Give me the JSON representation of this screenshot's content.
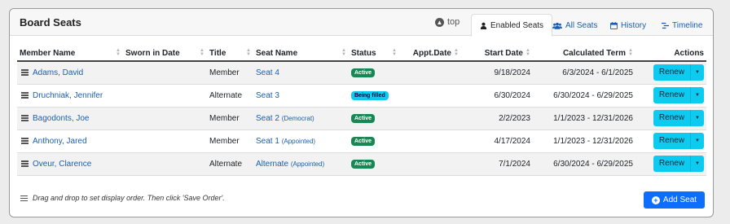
{
  "panel": {
    "title": "Board Seats"
  },
  "nav": {
    "top_label": "top",
    "tabs": [
      {
        "label": "Enabled Seats",
        "icon": "user-icon",
        "active": true
      },
      {
        "label": "All Seats",
        "icon": "users-icon",
        "active": false
      },
      {
        "label": "History",
        "icon": "calendar-icon",
        "active": false
      },
      {
        "label": "Timeline",
        "icon": "timeline-icon",
        "active": false
      }
    ]
  },
  "table": {
    "headers": [
      "Member Name",
      "Sworn in Date",
      "Title",
      "Seat Name",
      "Status",
      "Appt.Date",
      "Start Date",
      "Calculated Term",
      "Actions"
    ],
    "rows": [
      {
        "member": "Adams, David",
        "sworn": "",
        "title": "Member",
        "seat": "Seat 4",
        "seat_note": "",
        "status": "Active",
        "appt": "",
        "start": "9/18/2024",
        "term": "6/3/2024 - 6/1/2025",
        "action": "Renew"
      },
      {
        "member": "Druchniak, Jennifer",
        "sworn": "",
        "title": "Alternate",
        "seat": "Seat 3",
        "seat_note": "",
        "status": "Being filled",
        "appt": "",
        "start": "6/30/2024",
        "term": "6/30/2024 - 6/29/2025",
        "action": "Renew"
      },
      {
        "member": "Bagodonts, Joe",
        "sworn": "",
        "title": "Member",
        "seat": "Seat 2",
        "seat_note": "(Democrat)",
        "status": "Active",
        "appt": "",
        "start": "2/2/2023",
        "term": "1/1/2023 - 12/31/2026",
        "action": "Renew"
      },
      {
        "member": "Anthony, Jared",
        "sworn": "",
        "title": "Member",
        "seat": "Seat 1",
        "seat_note": "(Appointed)",
        "status": "Active",
        "appt": "",
        "start": "4/17/2024",
        "term": "1/1/2023 - 12/31/2026",
        "action": "Renew"
      },
      {
        "member": "Oveur, Clarence",
        "sworn": "",
        "title": "Alternate",
        "seat": "Alternate",
        "seat_note": "(Appointed)",
        "status": "Active",
        "appt": "",
        "start": "7/1/2024",
        "term": "6/30/2024 - 6/29/2025",
        "action": "Renew"
      }
    ]
  },
  "footer": {
    "note": "Drag and drop to set display order. Then click 'Save Order'.",
    "add_button": "Add Seat"
  },
  "colors": {
    "link": "#1a5fb4",
    "active_badge": "#198754",
    "filled_badge": "#0dcaf0",
    "renew_button": "#0dcaf0",
    "add_button": "#0d6efd"
  }
}
